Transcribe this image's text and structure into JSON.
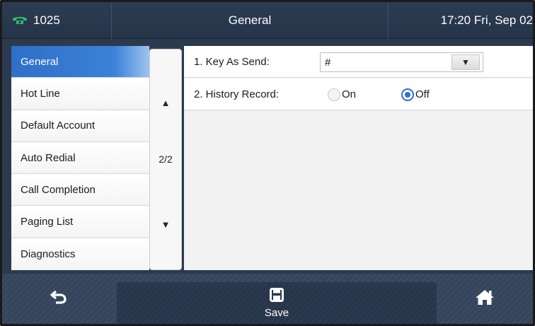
{
  "header": {
    "account": "1025",
    "title": "General",
    "clock": "17:20 Fri, Sep 02"
  },
  "menu": {
    "items": [
      {
        "label": "General",
        "active": true
      },
      {
        "label": "Hot Line"
      },
      {
        "label": "Default Account"
      },
      {
        "label": "Auto Redial"
      },
      {
        "label": "Call Completion"
      },
      {
        "label": "Paging List"
      },
      {
        "label": "Diagnostics"
      }
    ]
  },
  "scroller": {
    "page_indicator": "2/2"
  },
  "settings": {
    "key_as_send": {
      "label": "1. Key As Send:",
      "value": "#"
    },
    "history_record": {
      "label": "2. History Record:",
      "options": [
        "On",
        "Off"
      ],
      "selected": "Off"
    }
  },
  "softkeys": {
    "back_icon": "back-arrow-icon",
    "save_label": "Save",
    "save_icon": "floppy-disk-icon",
    "home_icon": "home-icon"
  },
  "colors": {
    "accent": "#2f6fc8",
    "phone_icon": "#27c06a",
    "topbar": "#2d3c52"
  }
}
